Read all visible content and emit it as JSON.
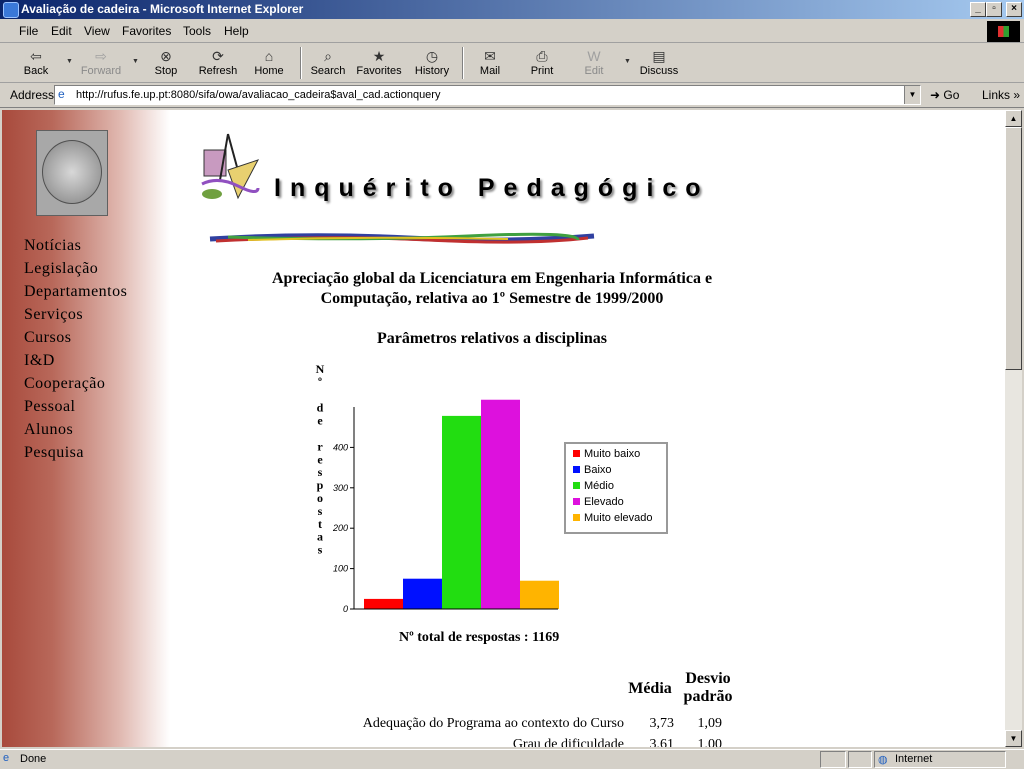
{
  "window": {
    "title": "Avaliação de cadeira - Microsoft Internet Explorer"
  },
  "menu": [
    "File",
    "Edit",
    "View",
    "Favorites",
    "Tools",
    "Help"
  ],
  "toolbar": {
    "back": "Back",
    "forward": "Forward",
    "stop": "Stop",
    "refresh": "Refresh",
    "home": "Home",
    "search": "Search",
    "favorites": "Favorites",
    "history": "History",
    "mail": "Mail",
    "print": "Print",
    "edit": "Edit",
    "discuss": "Discuss"
  },
  "address": {
    "label": "Address",
    "url": "http://rufus.fe.up.pt:8080/sifa/owa/avaliacao_cadeira$aval_cad.actionquery",
    "go": "Go",
    "links": "Links"
  },
  "nav": [
    "Notícias",
    "Legislação",
    "Departamentos",
    "Serviços",
    "Cursos",
    "I&D",
    "Cooperação",
    "Pessoal",
    "Alunos",
    "Pesquisa"
  ],
  "header": {
    "title": "Inquérito Pedagógico"
  },
  "main": {
    "heading_line1": "Apreciação global da Licenciatura em Engenharia Informática e",
    "heading_line2": "Computação, relativa ao 1º Semestre de 1999/2000",
    "subheading": "Parâmetros relativos a disciplinas",
    "total": "Nº total de respostas : 1169"
  },
  "chart_data": {
    "type": "bar",
    "ylabel": "Nº de respostas",
    "ylim": [
      0,
      500
    ],
    "yticks": [
      "0",
      "100",
      "200",
      "300",
      "400"
    ],
    "legend_position": "right",
    "categories": [
      "Muito baixo",
      "Baixo",
      "Médio",
      "Elevado",
      "Muito elevado"
    ],
    "values": [
      25,
      75,
      478,
      518,
      70
    ],
    "colors": [
      "#ff0000",
      "#0010ff",
      "#22dd11",
      "#dd11dd",
      "#ffb400"
    ]
  },
  "table": {
    "headers": {
      "media": "Média",
      "desvio_line1": "Desvio",
      "desvio_line2": "padrão"
    },
    "rows": [
      {
        "label": "Adequação do Programa ao contexto do Curso",
        "media": "3,73",
        "desvio": "1,09"
      },
      {
        "label": "Grau de dificuldade",
        "media": "3,61",
        "desvio": "1,00"
      }
    ]
  },
  "status": {
    "text": "Done",
    "zone": "Internet"
  }
}
